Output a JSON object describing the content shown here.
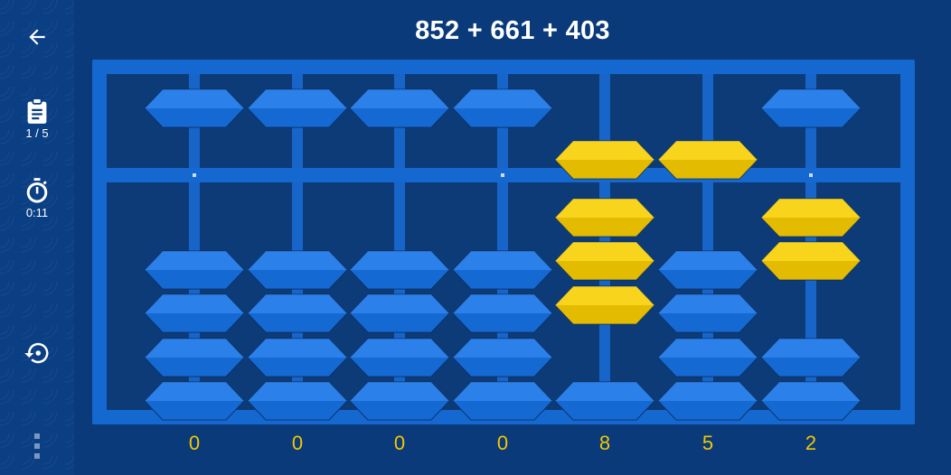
{
  "header": {
    "expression": "852 + 661 + 403"
  },
  "sidebar": {
    "back_icon": "arrow-left-icon",
    "task_icon": "clipboard-icon",
    "progress": "1 / 5",
    "timer_icon": "stopwatch-icon",
    "time": "0:11",
    "reset_icon": "reset-icon",
    "menu_icon": "vertical-dots-icon"
  },
  "abacus": {
    "rods": [
      {
        "digit": "0",
        "upper_active": false,
        "lower_active": 0
      },
      {
        "digit": "0",
        "upper_active": false,
        "lower_active": 0
      },
      {
        "digit": "0",
        "upper_active": false,
        "lower_active": 0
      },
      {
        "digit": "0",
        "upper_active": false,
        "lower_active": 0
      },
      {
        "digit": "8",
        "upper_active": true,
        "lower_active": 3
      },
      {
        "digit": "5",
        "upper_active": true,
        "lower_active": 0
      },
      {
        "digit": "2",
        "upper_active": false,
        "lower_active": 2
      }
    ],
    "colors": {
      "bead_inactive": "#1a72e0",
      "bead_active": "#f2c700",
      "frame": "#1568d0",
      "background": "#0a3a7a"
    }
  }
}
